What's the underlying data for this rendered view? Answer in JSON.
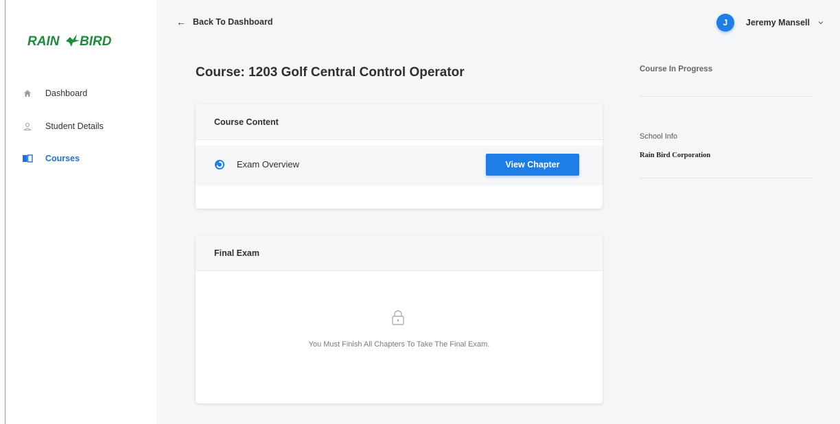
{
  "brand": {
    "logo_text": "RAIN BIRD",
    "color": "#1e8a3c"
  },
  "sidebar": {
    "items": [
      {
        "label": "Dashboard",
        "icon": "home-icon"
      },
      {
        "label": "Student Details",
        "icon": "user-icon"
      },
      {
        "label": "Courses",
        "icon": "book-icon",
        "active": true
      }
    ]
  },
  "header": {
    "back_label": "Back To Dashboard",
    "user": {
      "initial": "J",
      "name": "Jeremy Mansell"
    }
  },
  "main": {
    "title": "Course: 1203 Golf Central Control Operator",
    "course_content": {
      "header": "Course Content",
      "chapters": [
        {
          "label": "Exam Overview",
          "button_label": "View Chapter",
          "icon": "progress-circle-icon"
        }
      ]
    },
    "final_exam": {
      "header": "Final Exam",
      "message": "You Must Finish All Chapters To Take The Final Exam.",
      "icon": "lock-icon"
    }
  },
  "right_panel": {
    "status": "Course In Progress",
    "school_info_label": "School Info",
    "school_name": "Rain Bird Corporation"
  },
  "colors": {
    "accent": "#1f7de8",
    "active_nav": "#1f6fd8",
    "background": "#f5f6f8"
  }
}
